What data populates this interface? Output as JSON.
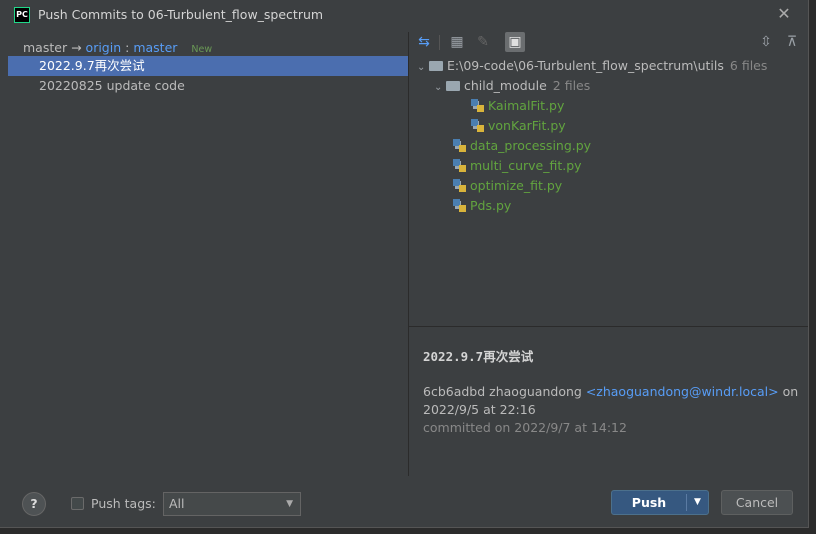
{
  "window": {
    "title": "Push Commits to 06-Turbulent_flow_spectrum",
    "app_icon_text": "PC"
  },
  "branch": {
    "local": "master",
    "arrow": "→",
    "remote": "origin",
    "sep": ":",
    "remote_branch": "master",
    "badge": "New"
  },
  "commits": [
    {
      "message": "2022.9.7再次尝试",
      "selected": true
    },
    {
      "message": "20220825 update code",
      "selected": false
    }
  ],
  "tree": {
    "root": {
      "path": "E:\\09-code\\06-Turbulent_flow_spectrum\\utils",
      "count": "6 files"
    },
    "folder": {
      "name": "child_module",
      "count": "2 files"
    },
    "child_files": [
      "KaimalFit.py",
      "vonKarFit.py"
    ],
    "files": [
      "data_processing.py",
      "multi_curve_fit.py",
      "optimize_fit.py",
      "Pds.py"
    ]
  },
  "details": {
    "title": "2022.9.7再次尝试",
    "hash_author": "6cb6adbd zhaoguandong",
    "email": "<zhaoguandong@windr.local>",
    "on": "on",
    "authored": "2022/9/5 at 22:16",
    "committed": "committed on 2022/9/7 at 14:12"
  },
  "footer": {
    "help": "?",
    "push_tags_label": "Push tags:",
    "push_tags_value": "All",
    "push_label": "Push",
    "cancel_label": "Cancel"
  },
  "colors": {
    "selection": "#4b6eaf",
    "link": "#589df6",
    "file_added": "#62a43f",
    "push_button": "#365880"
  }
}
